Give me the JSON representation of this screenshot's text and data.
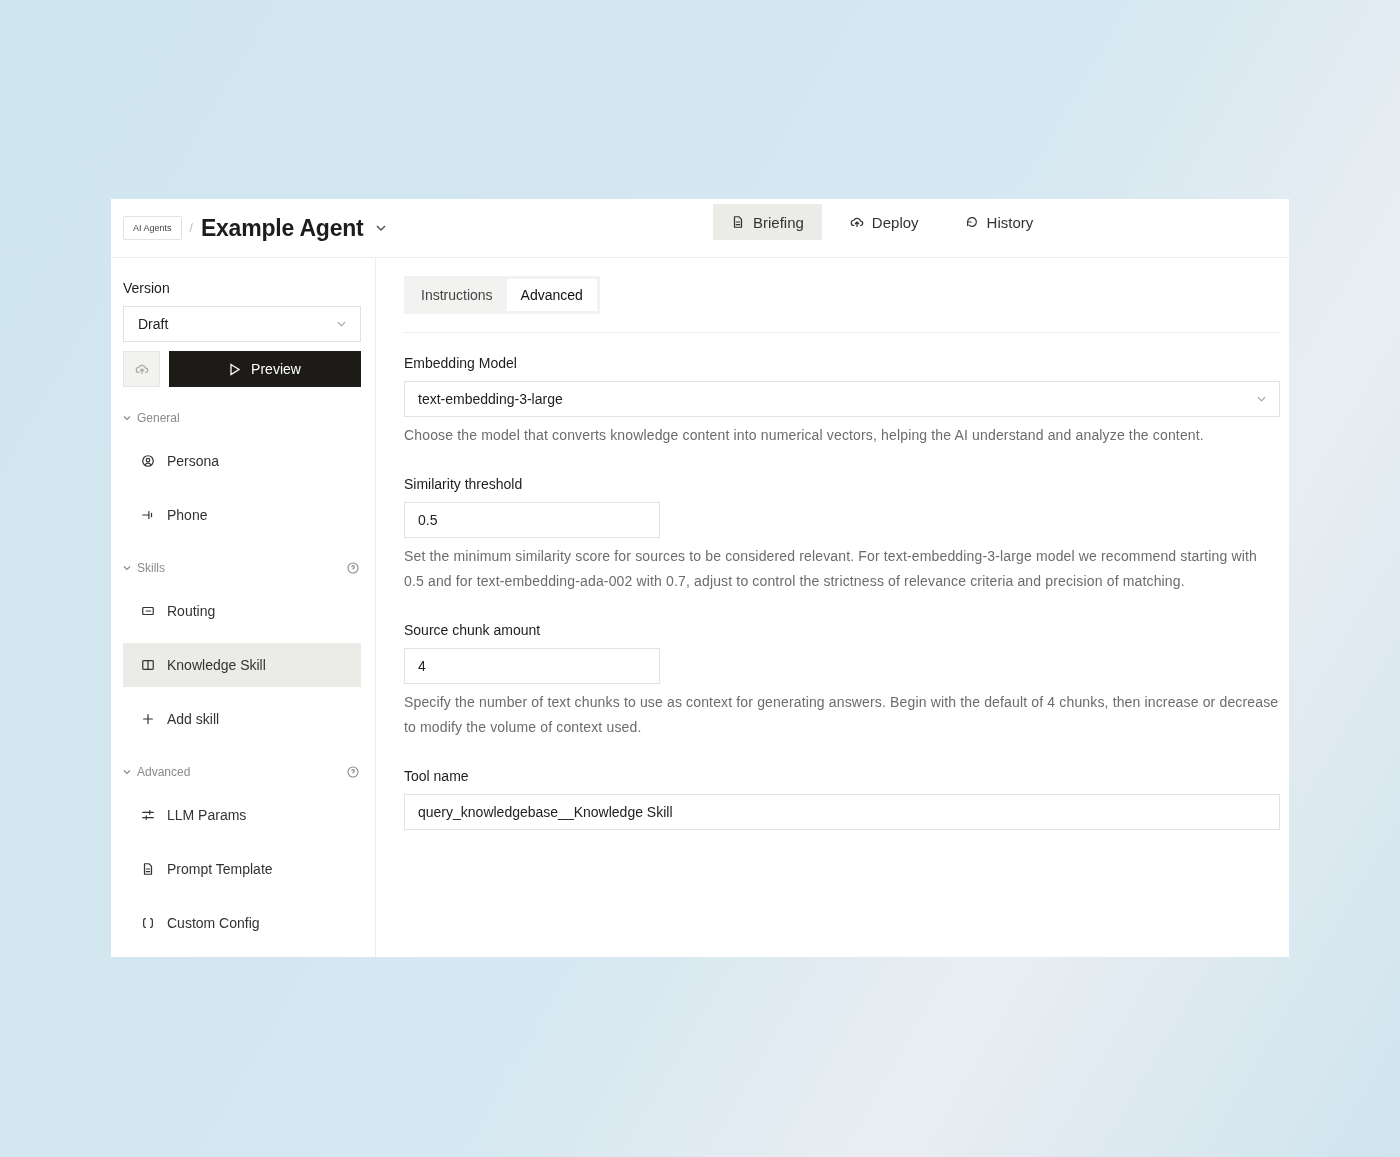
{
  "breadcrumb": "AI Agents",
  "separator": "/",
  "title": "Example Agent",
  "nav_tabs": [
    {
      "label": "Briefing",
      "selected": true
    },
    {
      "label": "Deploy",
      "selected": false
    },
    {
      "label": "History",
      "selected": false
    }
  ],
  "sidebar": {
    "version_label": "Version",
    "version_value": "Draft",
    "preview_button": "Preview",
    "sections": [
      {
        "title": "General",
        "expanded": true,
        "help": false,
        "items": [
          {
            "label": "Persona",
            "selected": false
          },
          {
            "label": "Phone",
            "selected": false
          }
        ]
      },
      {
        "title": "Skills",
        "expanded": true,
        "help": true,
        "items": [
          {
            "label": "Routing",
            "selected": false
          },
          {
            "label": "Knowledge Skill",
            "selected": true
          },
          {
            "label": "Add skill",
            "selected": false
          }
        ]
      },
      {
        "title": "Advanced",
        "expanded": true,
        "help": true,
        "items": [
          {
            "label": "LLM Params",
            "selected": false
          },
          {
            "label": "Prompt Template",
            "selected": false
          },
          {
            "label": "Custom Config",
            "selected": false
          }
        ]
      }
    ]
  },
  "content_tabs": [
    {
      "label": "Instructions",
      "selected": false
    },
    {
      "label": "Advanced",
      "selected": true
    }
  ],
  "fields": [
    {
      "kind": "select",
      "label": "Embedding Model",
      "value": "text-embedding-3-large",
      "help": "Choose the model that converts knowledge content into numerical vectors, helping the AI understand and analyze the content."
    },
    {
      "kind": "short",
      "label": "Similarity threshold",
      "value": "0.5",
      "help": "Set the minimum similarity score for sources to be considered relevant. For text-embedding-3-large model we recommend starting with 0.5 and for text-embedding-ada-002 with 0.7, adjust to control the strictness of relevance criteria and precision of matching."
    },
    {
      "kind": "short",
      "label": "Source chunk amount",
      "value": "4",
      "help": "Specify the number of text chunks to use as context for generating answers. Begin with the default of 4 chunks, then increase or decrease to modify the volume of context used."
    },
    {
      "kind": "wide",
      "label": "Tool name",
      "value": "query_knowledgebase__Knowledge Skill"
    }
  ]
}
